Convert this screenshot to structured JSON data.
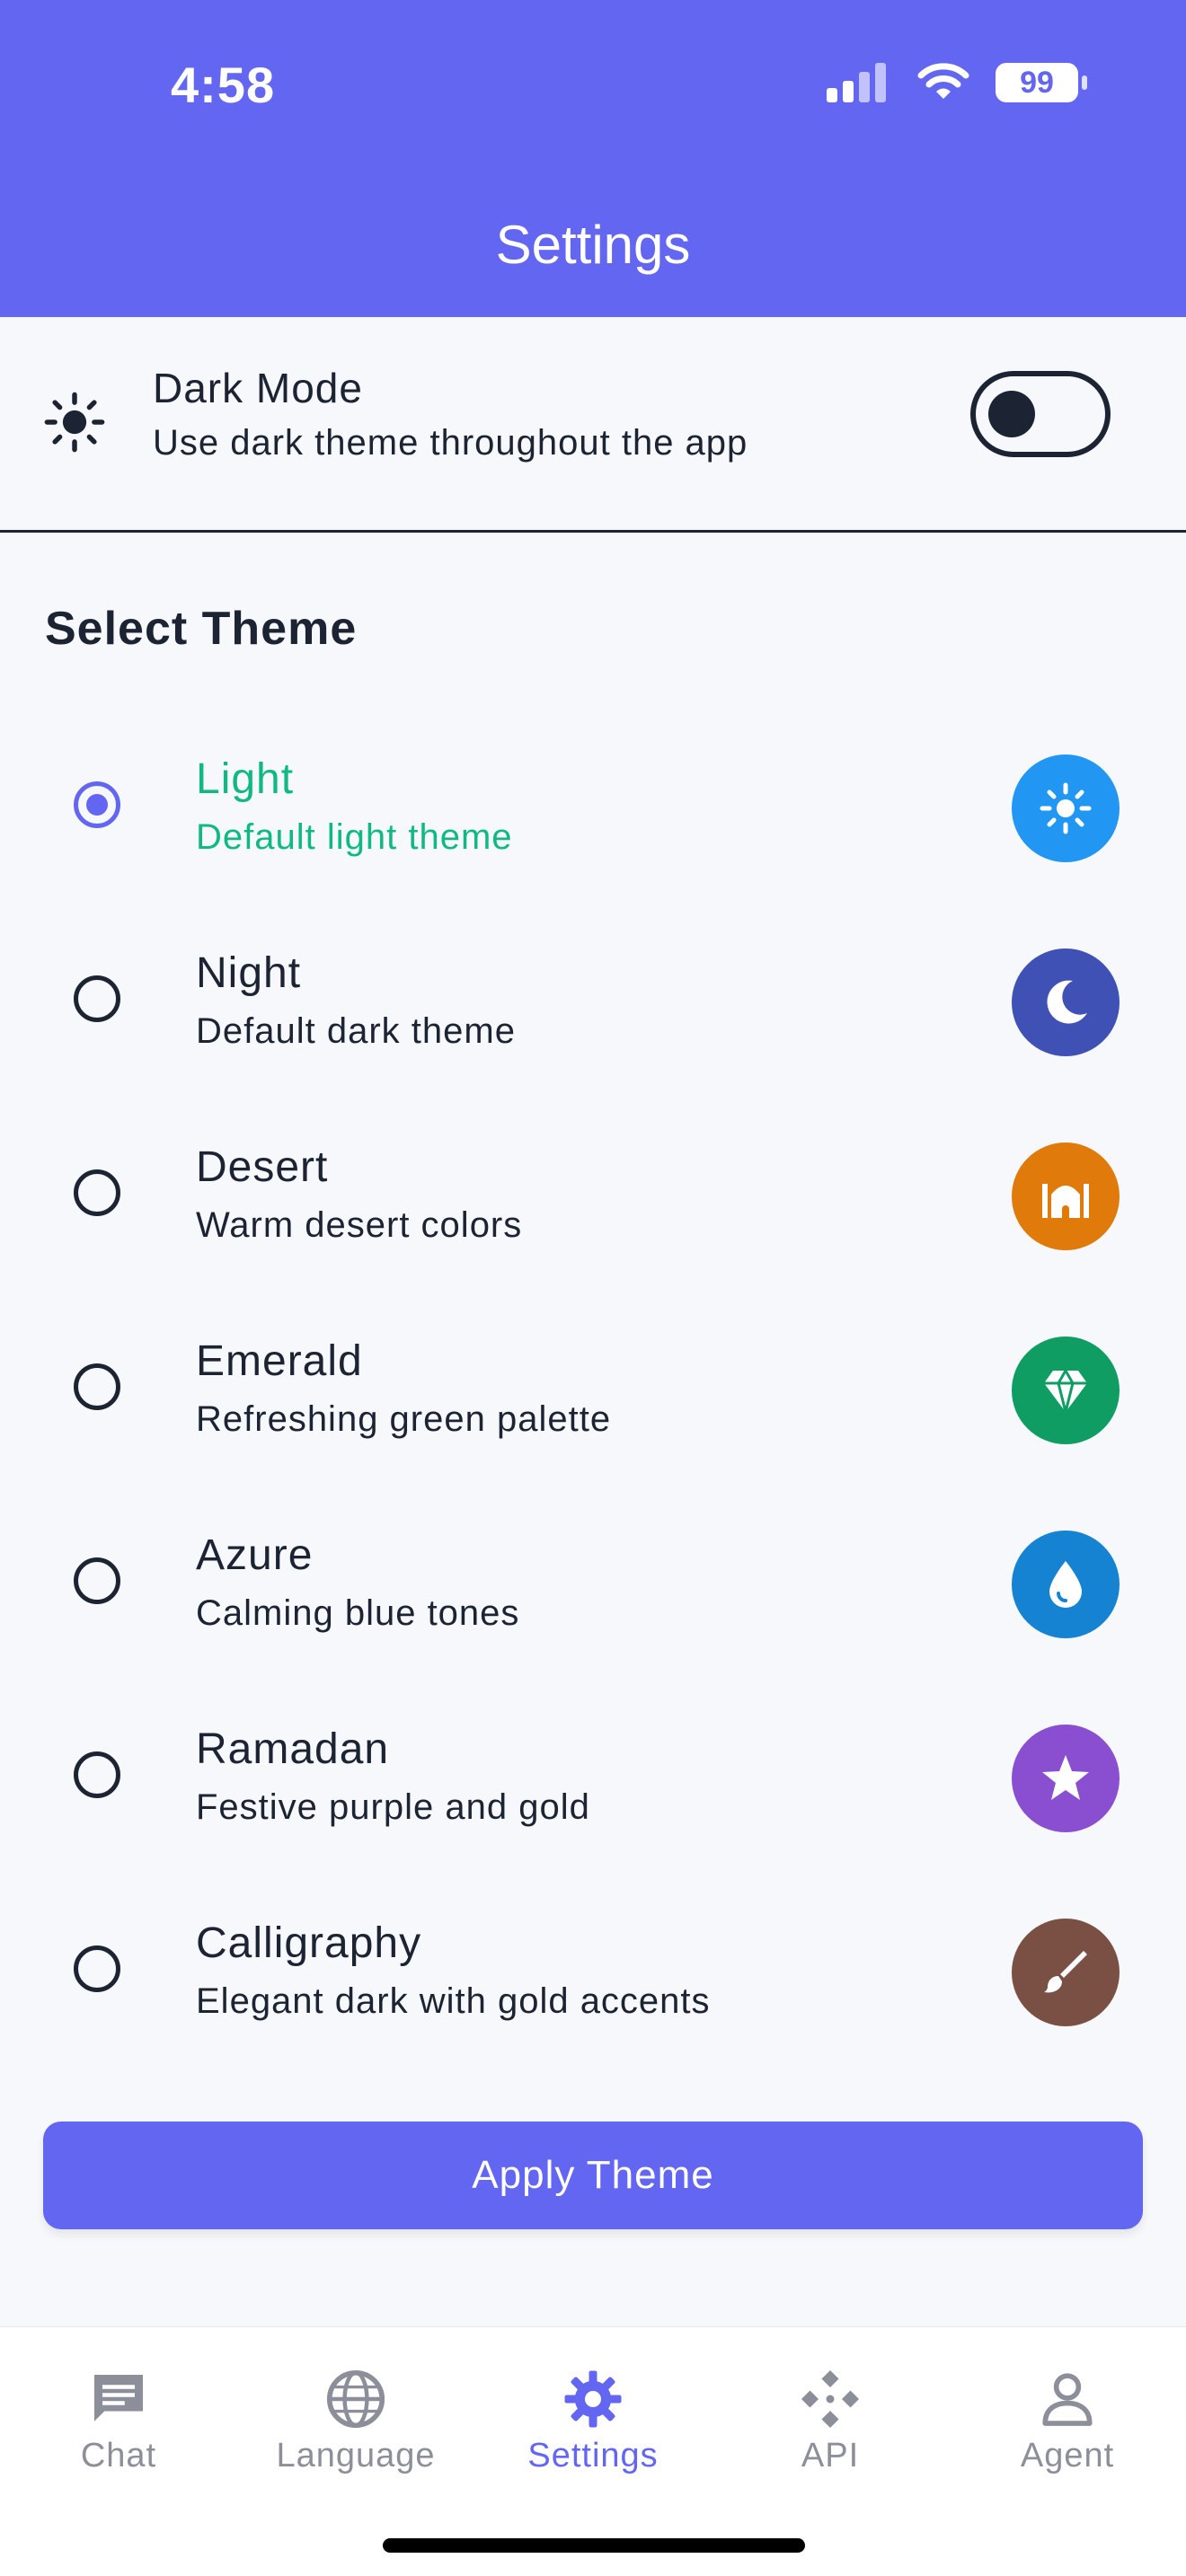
{
  "status": {
    "time": "4:58",
    "battery": "99"
  },
  "header": {
    "title": "Settings"
  },
  "dark_mode": {
    "title": "Dark Mode",
    "subtitle": "Use dark theme throughout the app",
    "enabled": false
  },
  "theme_section": {
    "title": "Select Theme",
    "items": [
      {
        "name": "Light",
        "desc": "Default light theme",
        "icon": "sun-icon",
        "color": "#2196f3",
        "selected": true
      },
      {
        "name": "Night",
        "desc": "Default dark theme",
        "icon": "moon-icon",
        "color": "#3f51b5",
        "selected": false
      },
      {
        "name": "Desert",
        "desc": "Warm desert colors",
        "icon": "mosque-icon",
        "color": "#e07a0b",
        "selected": false
      },
      {
        "name": "Emerald",
        "desc": "Refreshing green palette",
        "icon": "gem-icon",
        "color": "#0f9d64",
        "selected": false
      },
      {
        "name": "Azure",
        "desc": "Calming blue tones",
        "icon": "drop-icon",
        "color": "#1583d1",
        "selected": false
      },
      {
        "name": "Ramadan",
        "desc": "Festive purple and gold",
        "icon": "star-icon",
        "color": "#8a4fd0",
        "selected": false
      },
      {
        "name": "Calligraphy",
        "desc": "Elegant dark with gold accents",
        "icon": "brush-icon",
        "color": "#7b5044",
        "selected": false
      }
    ]
  },
  "apply_button": {
    "label": "Apply Theme"
  },
  "bottom_nav": {
    "items": [
      {
        "label": "Chat",
        "icon": "chat-icon",
        "active": false
      },
      {
        "label": "Language",
        "icon": "globe-icon",
        "active": false
      },
      {
        "label": "Settings",
        "icon": "gear-icon",
        "active": true
      },
      {
        "label": "API",
        "icon": "api-icon",
        "active": false
      },
      {
        "label": "Agent",
        "icon": "person-icon",
        "active": false
      }
    ]
  },
  "colors": {
    "primary": "#6366f1",
    "selected_text": "#10b981"
  }
}
